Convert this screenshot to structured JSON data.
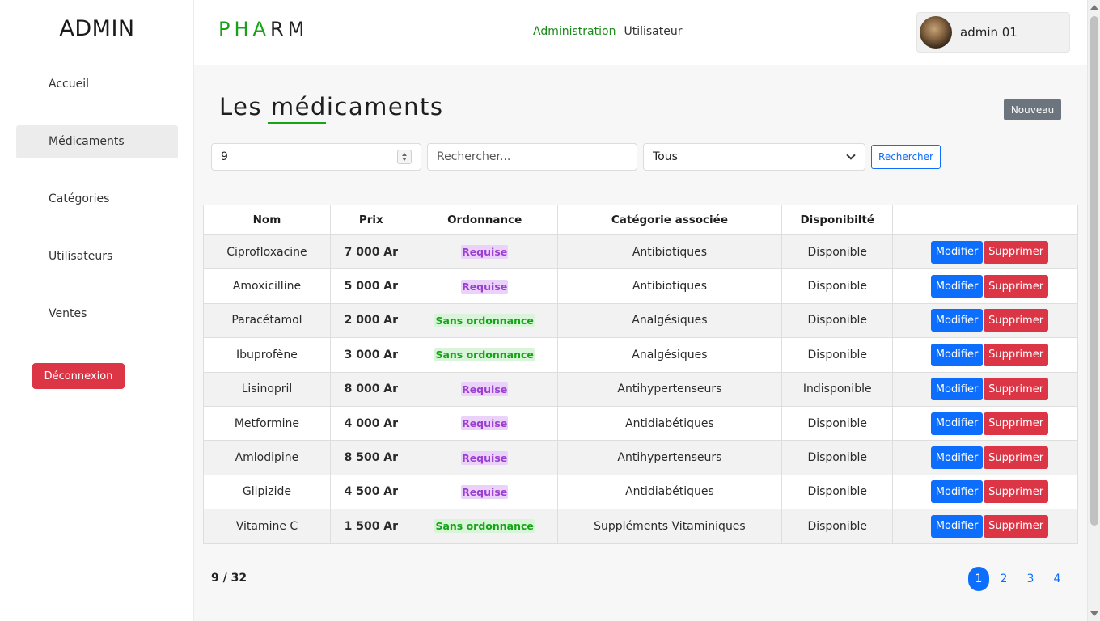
{
  "sidebar": {
    "brand": "ADMIN",
    "items": [
      {
        "label": "Accueil"
      },
      {
        "label": "Médicaments"
      },
      {
        "label": "Catégories"
      },
      {
        "label": "Utilisateurs"
      },
      {
        "label": "Ventes"
      }
    ],
    "logout_label": "Déconnexion"
  },
  "header": {
    "logo_part1": "PHA",
    "logo_part2": "RM",
    "nav": {
      "administration": "Administration",
      "utilisateur": "Utilisateur"
    },
    "user_name": "admin 01"
  },
  "main": {
    "title": "Les médicaments",
    "new_button": "Nouveau",
    "filters": {
      "per_page_value": "9",
      "search_placeholder": "Rechercher...",
      "category_selected": "Tous",
      "search_button": "Rechercher"
    },
    "table": {
      "headers": [
        "Nom",
        "Prix",
        "Ordonnance",
        "Catégorie associée",
        "Disponibilté",
        ""
      ],
      "edit_label": "Modifier",
      "delete_label": "Supprimer",
      "rows": [
        {
          "nom": "Ciprofloxacine",
          "prix": "7 000 Ar",
          "ordonnance": "Requise",
          "categorie": "Antibiotiques",
          "disponibilite": "Disponible"
        },
        {
          "nom": "Amoxicilline",
          "prix": "5 000 Ar",
          "ordonnance": "Requise",
          "categorie": "Antibiotiques",
          "disponibilite": "Disponible"
        },
        {
          "nom": "Paracétamol",
          "prix": "2 000 Ar",
          "ordonnance": "Sans ordonnance",
          "categorie": "Analgésiques",
          "disponibilite": "Disponible"
        },
        {
          "nom": "Ibuprofène",
          "prix": "3 000 Ar",
          "ordonnance": "Sans ordonnance",
          "categorie": "Analgésiques",
          "disponibilite": "Disponible"
        },
        {
          "nom": "Lisinopril",
          "prix": "8 000 Ar",
          "ordonnance": "Requise",
          "categorie": "Antihypertenseurs",
          "disponibilite": "Indisponible"
        },
        {
          "nom": "Metformine",
          "prix": "4 000 Ar",
          "ordonnance": "Requise",
          "categorie": "Antidiabétiques",
          "disponibilite": "Disponible"
        },
        {
          "nom": "Amlodipine",
          "prix": "8 500 Ar",
          "ordonnance": "Requise",
          "categorie": "Antihypertenseurs",
          "disponibilite": "Disponible"
        },
        {
          "nom": "Glipizide",
          "prix": "4 500 Ar",
          "ordonnance": "Requise",
          "categorie": "Antidiabétiques",
          "disponibilite": "Disponible"
        },
        {
          "nom": "Vitamine C",
          "prix": "1 500 Ar",
          "ordonnance": "Sans ordonnance",
          "categorie": "Suppléments Vitaminiques",
          "disponibilite": "Disponible"
        }
      ]
    },
    "count": "9 / 32",
    "pagination": {
      "pages": [
        "1",
        "2",
        "3",
        "4"
      ],
      "current": "1"
    }
  },
  "colors": {
    "accent_green": "#17a317",
    "primary_blue": "#0d6efd",
    "danger_red": "#dc3545",
    "secondary_gray": "#6c757d",
    "required_purple": "#9b3fcf"
  }
}
